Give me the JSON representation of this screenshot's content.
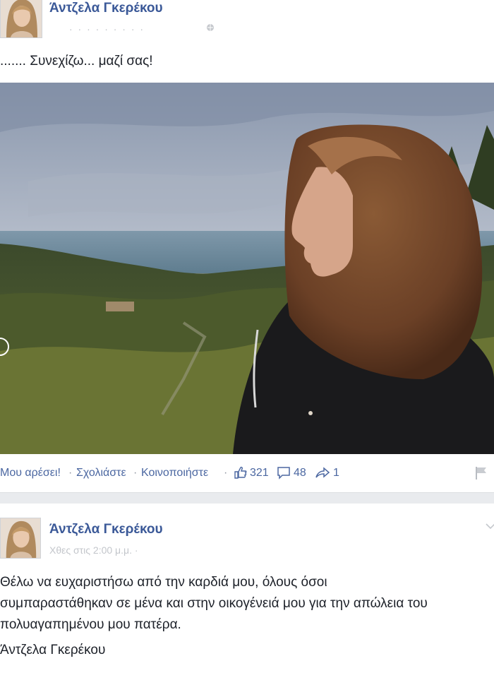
{
  "post1": {
    "author": "Άντζελα Γκερέκου",
    "meta": "· · · · · · · · ·",
    "text": "....... Συνεχίζω... μαζί σας!",
    "actions": {
      "like": "Μου αρέσει!",
      "comment": "Σχολιάστε",
      "share": "Κοινοποιήστε",
      "separator": "·",
      "like_count": "321",
      "comment_count": "48",
      "share_count": "1"
    }
  },
  "post2": {
    "author": "Άντζελα Γκερέκου",
    "meta": "Χθες στις 2:00 μ.μ. ·",
    "text_lines": [
      "Θέλω να ευχαριστήσω από την καρδιά μου, όλους όσοι",
      "συμπαραστάθηκαν σε μένα και στην οικογένειά μου για την απώλεια του",
      "πολυαγαπημένου μου πατέρα."
    ],
    "signature": "Άντζελα Γκερέκου"
  },
  "colors": {
    "link": "#3b5998",
    "action": "#4b67a1",
    "background": "#e9ebee"
  }
}
